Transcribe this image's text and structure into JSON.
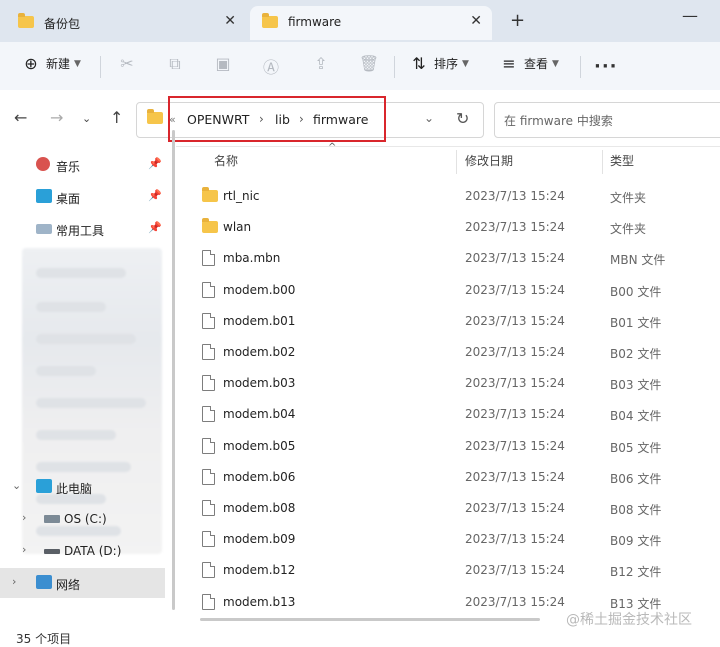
{
  "tabs": [
    {
      "label": "备份包",
      "active": false
    },
    {
      "label": "firmware",
      "active": true
    }
  ],
  "toolbar": {
    "new_label": "新建",
    "sort_label": "排序",
    "view_label": "查看"
  },
  "address": {
    "crumbs": [
      "OPENWRT",
      "lib",
      "firmware"
    ],
    "overflow": "«",
    "search_placeholder": "在 firmware 中搜索"
  },
  "sidebar": {
    "quick": [
      {
        "label": "音乐",
        "icon": "music-icon"
      },
      {
        "label": "桌面",
        "icon": "desktop-icon"
      },
      {
        "label": "常用工具",
        "icon": "drive-icon"
      }
    ],
    "tree": [
      {
        "label": "此电脑",
        "icon": "computer-icon"
      },
      {
        "label": "OS (C:)",
        "icon": "windows-drive-icon"
      },
      {
        "label": "DATA (D:)",
        "icon": "drive-icon"
      },
      {
        "label": "网络",
        "icon": "network-icon"
      }
    ]
  },
  "columns": {
    "name": "名称",
    "date": "修改日期",
    "type": "类型"
  },
  "files": [
    {
      "name": "rtl_nic",
      "date": "2023/7/13 15:24",
      "type": "文件夹",
      "kind": "folder"
    },
    {
      "name": "wlan",
      "date": "2023/7/13 15:24",
      "type": "文件夹",
      "kind": "folder"
    },
    {
      "name": "mba.mbn",
      "date": "2023/7/13 15:24",
      "type": "MBN 文件",
      "kind": "file"
    },
    {
      "name": "modem.b00",
      "date": "2023/7/13 15:24",
      "type": "B00 文件",
      "kind": "file"
    },
    {
      "name": "modem.b01",
      "date": "2023/7/13 15:24",
      "type": "B01 文件",
      "kind": "file"
    },
    {
      "name": "modem.b02",
      "date": "2023/7/13 15:24",
      "type": "B02 文件",
      "kind": "file"
    },
    {
      "name": "modem.b03",
      "date": "2023/7/13 15:24",
      "type": "B03 文件",
      "kind": "file"
    },
    {
      "name": "modem.b04",
      "date": "2023/7/13 15:24",
      "type": "B04 文件",
      "kind": "file"
    },
    {
      "name": "modem.b05",
      "date": "2023/7/13 15:24",
      "type": "B05 文件",
      "kind": "file"
    },
    {
      "name": "modem.b06",
      "date": "2023/7/13 15:24",
      "type": "B06 文件",
      "kind": "file"
    },
    {
      "name": "modem.b08",
      "date": "2023/7/13 15:24",
      "type": "B08 文件",
      "kind": "file"
    },
    {
      "name": "modem.b09",
      "date": "2023/7/13 15:24",
      "type": "B09 文件",
      "kind": "file"
    },
    {
      "name": "modem.b12",
      "date": "2023/7/13 15:24",
      "type": "B12 文件",
      "kind": "file"
    },
    {
      "name": "modem.b13",
      "date": "2023/7/13 15:24",
      "type": "B13 文件",
      "kind": "file"
    }
  ],
  "status": {
    "count": "35 个项目"
  },
  "watermark": "@稀土掘金技术社区",
  "colors": {
    "highlight_box": "#d9262c",
    "folder": "#f6c54a",
    "tabbar": "#dfe6ef"
  }
}
